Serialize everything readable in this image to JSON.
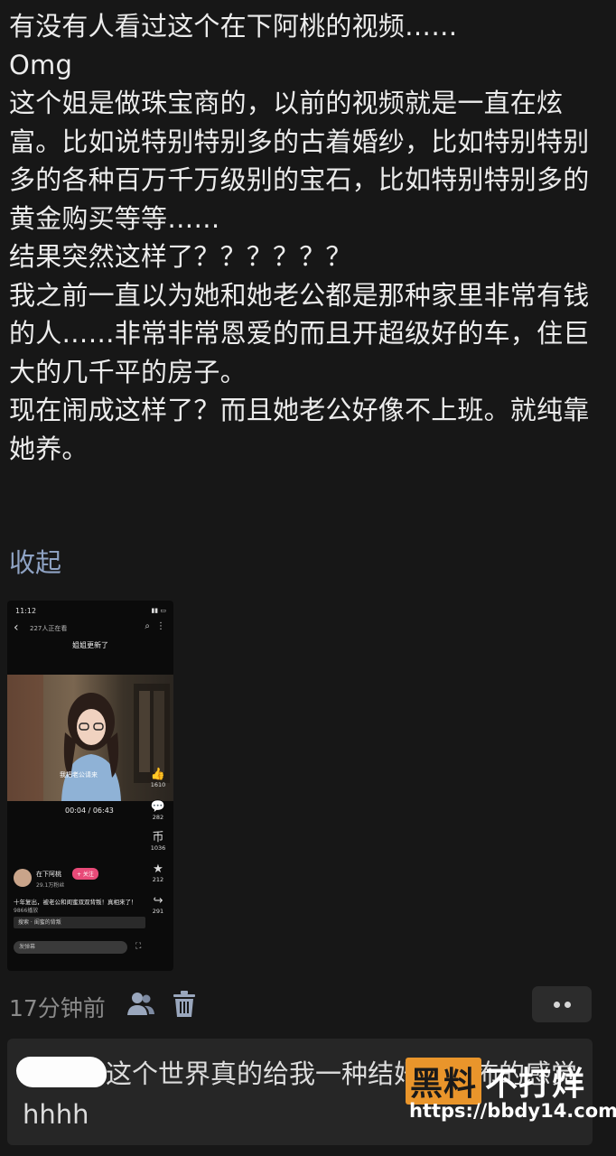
{
  "post": {
    "body": "有没有人看过这个在下阿桃的视频……\nOmg\n这个姐是做珠宝商的，以前的视频就是一直在炫富。比如说特别特别多的古着婚纱，比如特别特别多的各种百万千万级别的宝石，比如特别特别多的黄金购买等等……\n结果突然这样了？？？？？？\n我之前一直以为她和她老公都是那种家里非常有钱的人……非常非常恩爱的而且开超级好的车，住巨大的几千平的房子。\n现在闹成这样了？而且她老公好像不上班。就纯靠她养。",
    "collapse_label": "收起"
  },
  "embedded_screenshot": {
    "status_time": "11:12",
    "status_right": "▮▮ ▭",
    "back_icon": "back-arrow-icon",
    "watch_count": "227人正在看",
    "headline": "姐姐更新了",
    "subtitle": "我把老公请来",
    "time": "00:04 / 06:43",
    "likes": "1610",
    "comments": "282",
    "coins": "1036",
    "stars": "212",
    "shares": "291",
    "author": "在下阿桃",
    "follow_label": "+ 关注",
    "fans": "29.1万粉丝",
    "caption": "十年复出，被老公和闺蜜双双背叛！真相来了！",
    "plays": "9866播放",
    "search_hint": "搜索 · 闺蜜的背叛",
    "input_placeholder": "发弹幕"
  },
  "meta": {
    "time": "17分钟前",
    "icons": [
      "user-icon",
      "trash-icon",
      "more-icon"
    ]
  },
  "reply": {
    "text": "这个世界真的给我一种结婚很恐怖的感觉hhhh"
  },
  "watermark": {
    "logo_box": "黑料",
    "logo_text": "不打烊",
    "url": "https://bbdy14.com"
  },
  "colors": {
    "background": "#171717",
    "link": "#8fa3c4",
    "muted": "#8a8a8a",
    "follow": "#e84a78",
    "watermark_accent": "#e9952b"
  }
}
